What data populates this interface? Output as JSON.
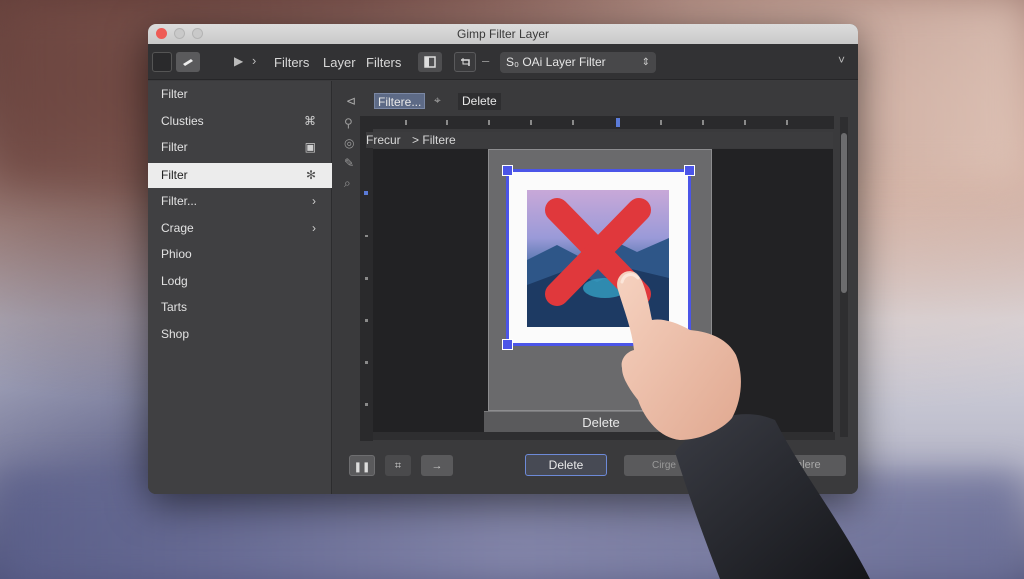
{
  "window": {
    "title": "Gimp Filter Layer"
  },
  "toolbar": {
    "crumb_1": "Filters",
    "crumb_2": "Layer",
    "crumb_3": "Filters",
    "select_value": "S₀ OAi Layer Filter"
  },
  "canvas_toolbar": {
    "label_1": "Filtere...",
    "label_2": "Delete"
  },
  "breadcrumb": {
    "part_1": "Frecur",
    "separator": ">",
    "part_2": "Filtere"
  },
  "sidebar": {
    "items": [
      {
        "label": "Filter"
      },
      {
        "label": "Clusties"
      },
      {
        "label": "Filter"
      },
      {
        "label": "Filter"
      },
      {
        "label": "Filter..."
      },
      {
        "label": "Crage"
      },
      {
        "label": "Phioo"
      },
      {
        "label": "Lodg"
      },
      {
        "label": "Tarts"
      },
      {
        "label": "Shop"
      }
    ]
  },
  "canvas": {
    "delete_strip_label": "Delete"
  },
  "bottom": {
    "delete_label": "Delete",
    "cancel_label": "Cirge",
    "extra_label": "Falere"
  },
  "colors": {
    "accent_blue": "#4b55e8",
    "delete_mark_red": "#e0383c",
    "window_bg": "#3b3b3d",
    "active_item_bg": "#ececec"
  },
  "icons": [
    "play-icon",
    "chevron-right-icon",
    "layers-icon",
    "crop-icon",
    "chevron-down-icon",
    "cursor-icon",
    "eye-icon",
    "zoom-icon",
    "settings-icon"
  ]
}
